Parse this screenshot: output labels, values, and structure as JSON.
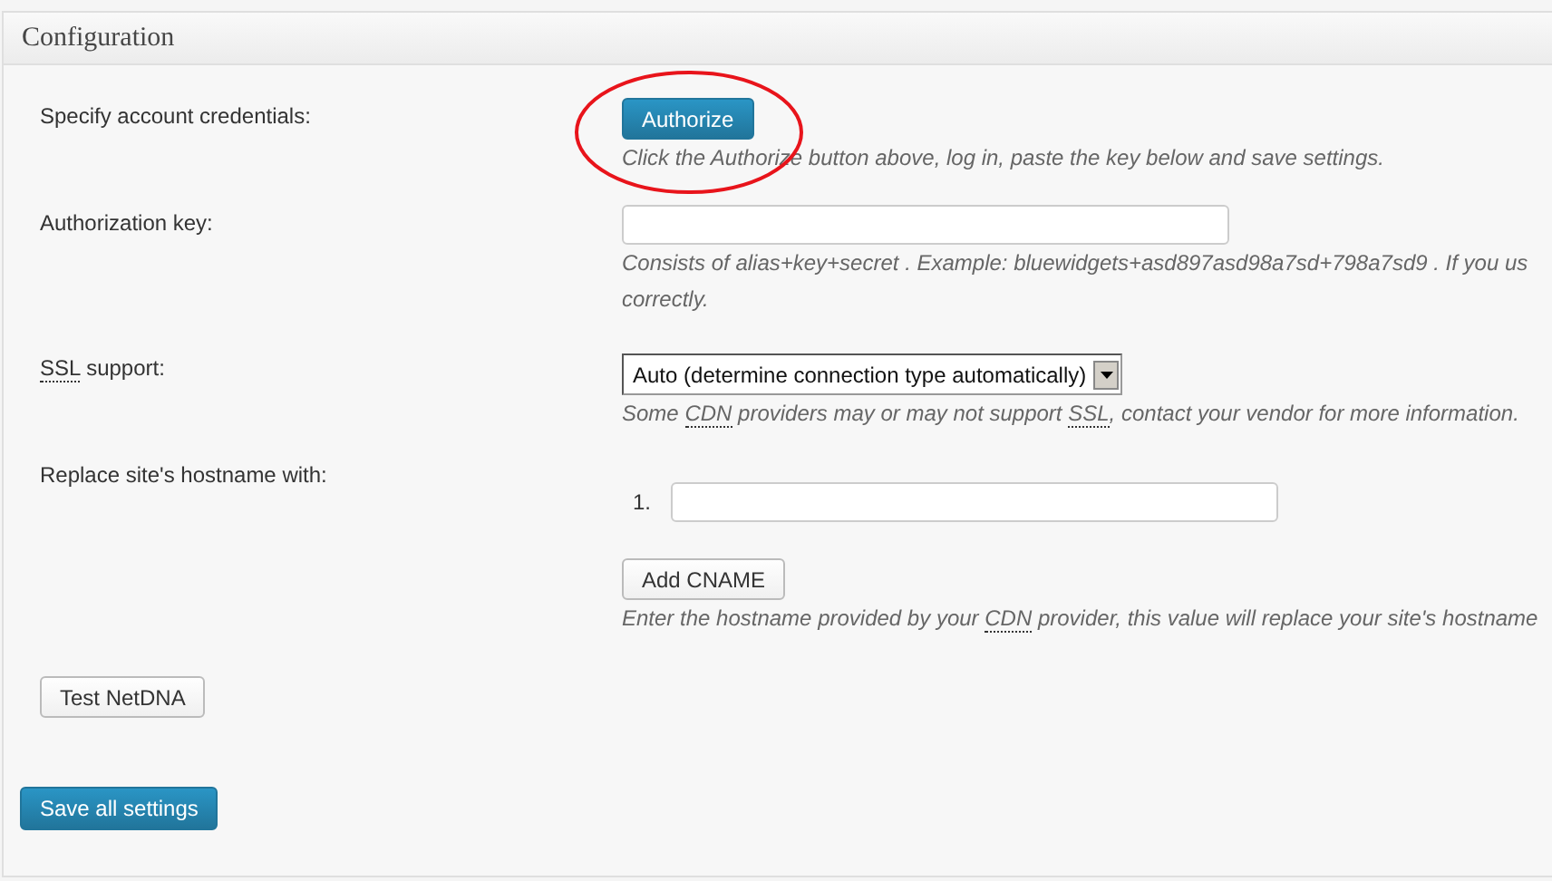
{
  "panel": {
    "title": "Configuration"
  },
  "rows": [
    {
      "label": [
        {
          "text": "Specify account credentials:",
          "kind": "plain"
        }
      ],
      "kind": "button",
      "button": {
        "label": "Authorize",
        "primary": true,
        "circled": true
      },
      "hint": [
        {
          "text": "Click the Authorize button above, log in, paste the key below and save settings.",
          "kind": "plain"
        }
      ]
    },
    {
      "label": [
        {
          "text": "Authorization key:",
          "kind": "plain"
        }
      ],
      "kind": "text",
      "hint": [
        {
          "text": "Consists of alias+key+secret . Example: bluewidgets+asd897asd98a7sd+798a7sd9 . If you us",
          "kind": "plain"
        }
      ],
      "hint_more": "correctly."
    },
    {
      "label": [
        {
          "text": "SSL",
          "kind": "abbr"
        },
        {
          "text": " support:",
          "kind": "plain"
        }
      ],
      "kind": "select",
      "value": "Auto (determine connection type automatically)",
      "hint": [
        {
          "text": "Some ",
          "kind": "plain"
        },
        {
          "text": "CDN",
          "kind": "abbr"
        },
        {
          "text": " providers may or may not support ",
          "kind": "plain"
        },
        {
          "text": "SSL",
          "kind": "abbr"
        },
        {
          "text": ", contact your vendor for more information.",
          "kind": "plain"
        }
      ]
    },
    {
      "label": [
        {
          "text": "Replace site's hostname with:",
          "kind": "plain"
        }
      ],
      "kind": "list",
      "items": [
        {
          "number": "1."
        }
      ],
      "button": {
        "label": "Add CNAME",
        "primary": false,
        "circled": false
      },
      "hint": [
        {
          "text": "Enter the hostname provided by your ",
          "kind": "plain"
        },
        {
          "text": "CDN",
          "kind": "abbr"
        },
        {
          "text": " provider, this value will replace your site's hostname",
          "kind": "plain"
        }
      ]
    }
  ],
  "test_button": {
    "label": "Test NetDNA",
    "primary": false
  },
  "save_button": {
    "label": "Save all settings",
    "primary": true
  }
}
